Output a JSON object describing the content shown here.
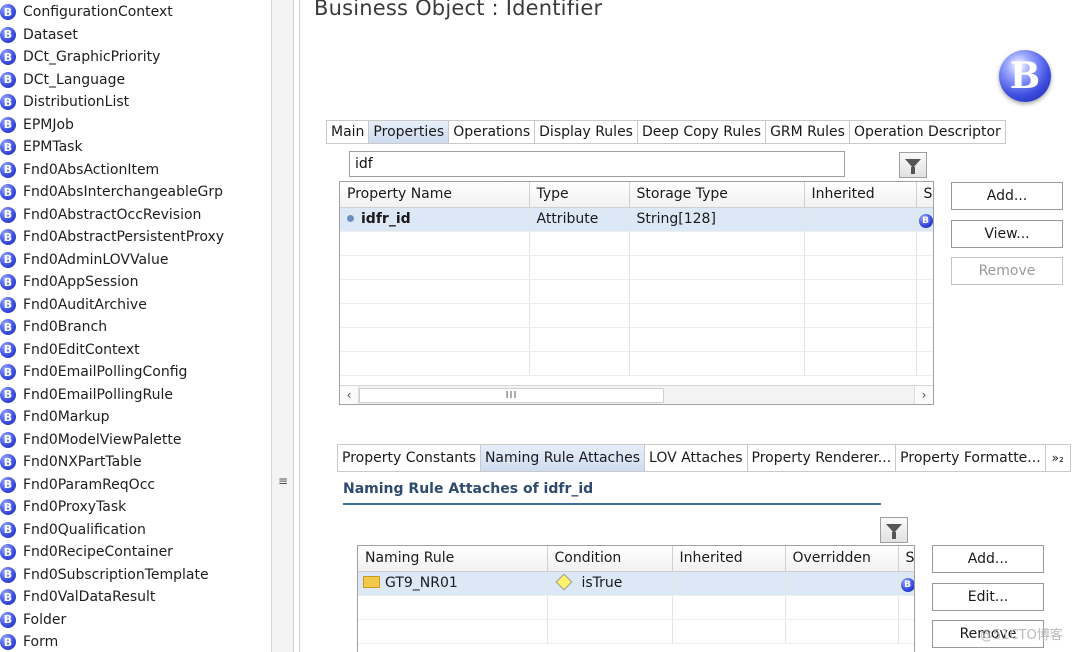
{
  "tree": {
    "items": [
      "ConfigurationContext",
      "Dataset",
      "DCt_GraphicPriority",
      "DCt_Language",
      "DistributionList",
      "EPMJob",
      "EPMTask",
      "Fnd0AbsActionItem",
      "Fnd0AbsInterchangeableGrp",
      "Fnd0AbstractOccRevision",
      "Fnd0AbstractPersistentProxy",
      "Fnd0AdminLOVValue",
      "Fnd0AppSession",
      "Fnd0AuditArchive",
      "Fnd0Branch",
      "Fnd0EditContext",
      "Fnd0EmailPollingConfig",
      "Fnd0EmailPollingRule",
      "Fnd0Markup",
      "Fnd0ModelViewPalette",
      "Fnd0NXPartTable",
      "Fnd0ParamReqOcc",
      "Fnd0ProxyTask",
      "Fnd0Qualification",
      "Fnd0RecipeContainer",
      "Fnd0SubscriptionTemplate",
      "Fnd0ValDataResult",
      "Folder",
      "Form"
    ],
    "icon": "business-object-icon",
    "icon_letter": "B"
  },
  "splitter": {
    "handle_glyph": "≡"
  },
  "editor": {
    "title": "Business Object : Identifier",
    "logo_letter": "B",
    "tabs": [
      {
        "label": "Main",
        "active": false
      },
      {
        "label": "Properties",
        "active": true
      },
      {
        "label": "Operations",
        "active": false
      },
      {
        "label": "Display Rules",
        "active": false
      },
      {
        "label": "Deep Copy Rules",
        "active": false
      },
      {
        "label": "GRM Rules",
        "active": false
      },
      {
        "label": "Operation Descriptor",
        "active": false
      }
    ]
  },
  "properties": {
    "filter_value": "idf",
    "filter_icon": "funnel-icon",
    "columns": [
      "Property Name",
      "Type",
      "Storage Type",
      "Inherited",
      "S"
    ],
    "rows": [
      {
        "name": "idfr_id",
        "type": "Attribute",
        "storage": "String[128]",
        "inherited": "",
        "s_icon": "B"
      }
    ],
    "scroll_thumb_glyph": "III",
    "buttons": {
      "add": "Add...",
      "view": "View...",
      "remove": "Remove"
    }
  },
  "subtabs": {
    "tabs": [
      {
        "label": "Property Constants",
        "active": false
      },
      {
        "label": "Naming Rule Attaches",
        "active": true
      },
      {
        "label": "LOV Attaches",
        "active": false
      },
      {
        "label": "Property Renderer...",
        "active": false
      },
      {
        "label": "Property Formatte...",
        "active": false
      }
    ],
    "overflow_label": "»₂"
  },
  "naming_rules": {
    "section_title": "Naming Rule Attaches of idfr_id",
    "filter_icon": "funnel-icon",
    "columns": [
      "Naming Rule",
      "Condition",
      "Inherited",
      "Overridden",
      "S"
    ],
    "rows": [
      {
        "rule": "GT9_NR01",
        "condition": "isTrue",
        "inherited": "",
        "overridden": "",
        "s_icon": "B"
      }
    ],
    "buttons": {
      "add": "Add...",
      "edit": "Edit...",
      "remove": "Remove"
    }
  },
  "watermark": "@51CTO博客"
}
